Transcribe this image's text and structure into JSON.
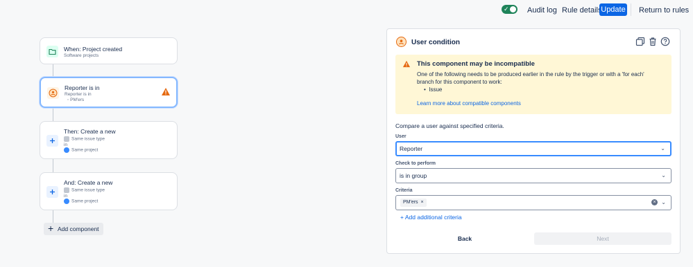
{
  "topbar": {
    "audit_log": "Audit log",
    "rule_details": "Rule details",
    "update": "Update",
    "return": "Return to rules"
  },
  "canvas": {
    "cards": [
      {
        "title": "When: Project created",
        "sub1": "Software projects",
        "icon": "folder-icon"
      },
      {
        "title": "Reporter is in",
        "sub1": "Reporter is in",
        "sub2": "PM'ers",
        "icon": "user-icon"
      },
      {
        "title": "Then: Create a new",
        "sub1": "Same issue type",
        "sub2": "in",
        "sub3": "Same project",
        "icon": "plus-icon"
      },
      {
        "title": "And: Create a new",
        "sub1": "Same issue type",
        "sub2": "in",
        "sub3": "Same project",
        "icon": "plus-icon"
      }
    ],
    "add_component": "Add component"
  },
  "panel": {
    "title": "User condition",
    "warning": {
      "title": "This component may be incompatible",
      "text": "One of the following needs to be produced earlier in the rule by the trigger or with a 'for each' branch for this component to work:",
      "bullet": "Issue",
      "link": "Learn more about compatible components"
    },
    "intro": "Compare a user against specified criteria.",
    "user_label": "User",
    "user_value": "Reporter",
    "check_label": "Check to perform",
    "check_value": "is in group",
    "criteria_label": "Criteria",
    "criteria_tag": "PM'ers",
    "add_criteria": "+ Add additional criteria",
    "back": "Back",
    "next": "Next"
  },
  "colors": {
    "primary": "#0c66e4",
    "toggle_on": "#1f845a",
    "warning_bg": "#fff7d6",
    "warning_icon": "#e56910"
  }
}
